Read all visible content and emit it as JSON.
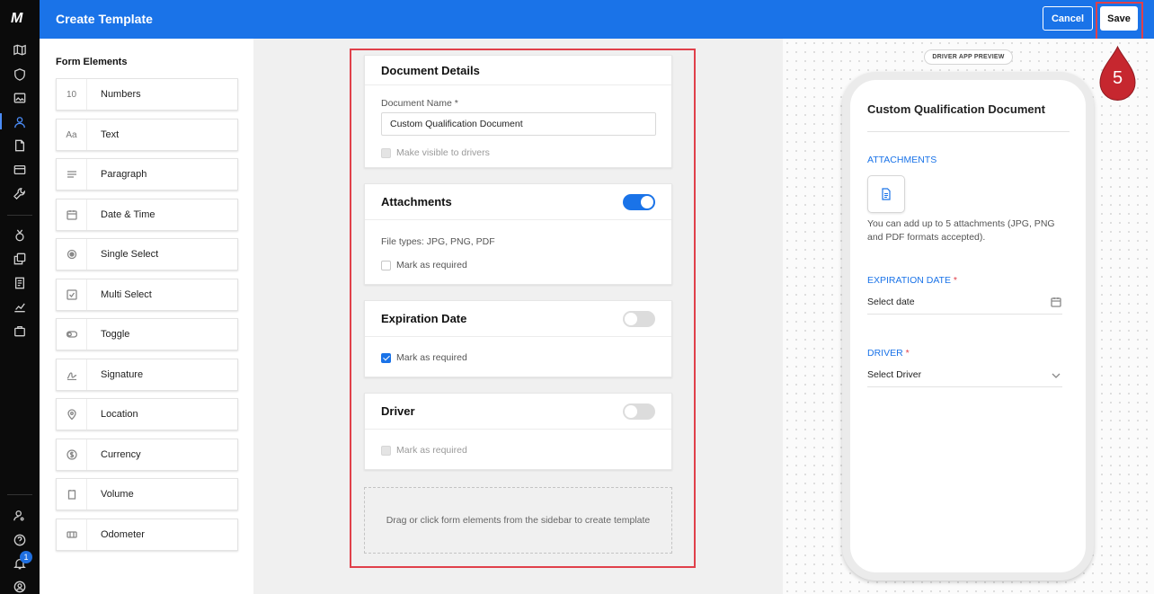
{
  "header": {
    "title": "Create Template",
    "cancel_label": "Cancel",
    "save_label": "Save"
  },
  "notifications": {
    "count": "1"
  },
  "sidebar": {
    "title": "Form Elements",
    "items": [
      {
        "icon_text": "10",
        "icon": "numbers-icon",
        "label": "Numbers"
      },
      {
        "icon_text": "Aa",
        "icon": "text-icon",
        "label": "Text"
      },
      {
        "icon_text": "",
        "icon": "paragraph-icon",
        "label": "Paragraph"
      },
      {
        "icon_text": "",
        "icon": "calendar-icon",
        "label": "Date & Time"
      },
      {
        "icon_text": "",
        "icon": "radio-icon",
        "label": "Single Select"
      },
      {
        "icon_text": "",
        "icon": "checkbox-icon",
        "label": "Multi Select"
      },
      {
        "icon_text": "",
        "icon": "toggle-icon",
        "label": "Toggle"
      },
      {
        "icon_text": "",
        "icon": "signature-icon",
        "label": "Signature"
      },
      {
        "icon_text": "",
        "icon": "location-pin-icon",
        "label": "Location"
      },
      {
        "icon_text": "",
        "icon": "currency-icon",
        "label": "Currency"
      },
      {
        "icon_text": "",
        "icon": "volume-icon",
        "label": "Volume"
      },
      {
        "icon_text": "",
        "icon": "odometer-icon",
        "label": "Odometer"
      }
    ]
  },
  "builder": {
    "document_details": {
      "title": "Document Details",
      "name_label": "Document Name *",
      "name_value": "Custom Qualification Document",
      "visible_label": "Make visible to drivers"
    },
    "attachments": {
      "title": "Attachments",
      "enabled": true,
      "file_types": "File types: JPG, PNG, PDF",
      "required_label": "Mark as required"
    },
    "expiration": {
      "title": "Expiration Date",
      "enabled": false,
      "required_label": "Mark as required"
    },
    "driver": {
      "title": "Driver",
      "enabled": false,
      "required_label": "Mark as required"
    },
    "dropzone_text": "Drag or click form elements from the sidebar to create template"
  },
  "preview": {
    "badge": "DRIVER APP PREVIEW",
    "title": "Custom Qualification Document",
    "attachments_label": "ATTACHMENTS",
    "attachments_note": "You can add up to 5 attachments (JPG, PNG and PDF formats accepted).",
    "expiration_label": "EXPIRATION DATE",
    "expiration_placeholder": "Select date",
    "driver_label": "DRIVER",
    "driver_placeholder": "Select Driver",
    "required_mark": "*"
  },
  "annotation": {
    "step_number": "5"
  },
  "colors": {
    "accent": "#1a73e8",
    "highlight": "#e0404a",
    "rail": "#0b0b0b"
  }
}
